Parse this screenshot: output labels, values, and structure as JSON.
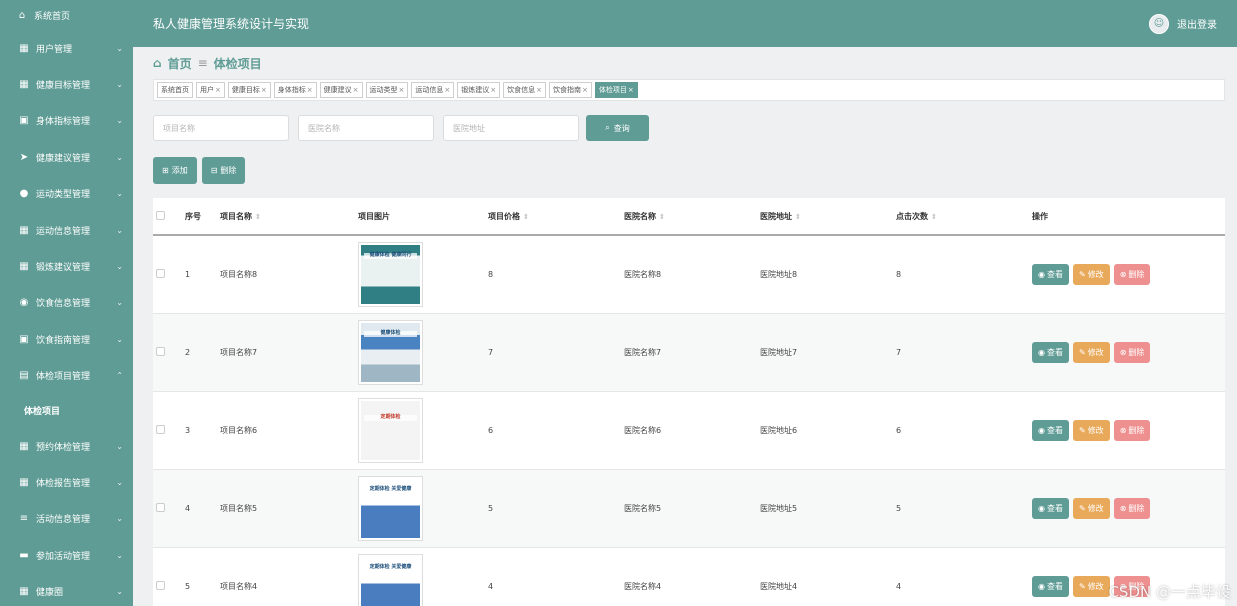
{
  "sidebar": {
    "home": {
      "label": "系统首页"
    },
    "items": [
      {
        "label": "用户管理",
        "icon": "grid-icon"
      },
      {
        "label": "健康目标管理",
        "icon": "grid-icon"
      },
      {
        "label": "身体指标管理",
        "icon": "clipboard-icon"
      },
      {
        "label": "健康建议管理",
        "icon": "send-icon"
      },
      {
        "label": "运动类型管理",
        "icon": "user-icon"
      },
      {
        "label": "运动信息管理",
        "icon": "grid-icon"
      },
      {
        "label": "锻炼建议管理",
        "icon": "grid-icon"
      },
      {
        "label": "饮食信息管理",
        "icon": "bulb-icon"
      },
      {
        "label": "饮食指南管理",
        "icon": "clipboard-icon"
      },
      {
        "label": "体检项目管理",
        "icon": "comment-icon",
        "expanded": true
      },
      {
        "label": "预约体检管理",
        "icon": "grid-icon"
      },
      {
        "label": "体检报告管理",
        "icon": "grid-icon"
      },
      {
        "label": "活动信息管理",
        "icon": "list-icon"
      },
      {
        "label": "参加活动管理",
        "icon": "briefcase-icon"
      },
      {
        "label": "健康圈",
        "icon": "grid-icon"
      }
    ],
    "sub_item": {
      "label": "体检项目"
    }
  },
  "header": {
    "title": "私人健康管理系统设计与实现",
    "logout": "退出登录"
  },
  "breadcrumb": {
    "home": "首页",
    "sep": "≡",
    "current": "体检项目"
  },
  "tags": [
    {
      "label": "系统首页",
      "closable": false
    },
    {
      "label": "用户",
      "closable": true
    },
    {
      "label": "健康目标",
      "closable": true
    },
    {
      "label": "身体指标",
      "closable": true
    },
    {
      "label": "健康建议",
      "closable": true
    },
    {
      "label": "运动类型",
      "closable": true
    },
    {
      "label": "运动信息",
      "closable": true
    },
    {
      "label": "锻炼建议",
      "closable": true
    },
    {
      "label": "饮食信息",
      "closable": true
    },
    {
      "label": "饮食指南",
      "closable": true
    },
    {
      "label": "体检项目",
      "closable": true,
      "active": true
    }
  ],
  "search": {
    "name_placeholder": "项目名称",
    "hospital_placeholder": "医院名称",
    "address_placeholder": "医院地址",
    "button": "查询"
  },
  "actions": {
    "add": "添加",
    "delete": "删除"
  },
  "table": {
    "headers": {
      "idx": "序号",
      "name": "项目名称",
      "image": "项目图片",
      "price": "项目价格",
      "hospital": "医院名称",
      "address": "医院地址",
      "clicks": "点击次数",
      "ops": "操作"
    },
    "op_labels": {
      "view": "查看",
      "edit": "修改",
      "del": "删除"
    },
    "rows": [
      {
        "idx": "1",
        "name": "项目名称8",
        "price": "8",
        "hospital": "医院名称8",
        "address": "医院地址8",
        "clicks": "8",
        "poster_text": "健康体检 健康同行"
      },
      {
        "idx": "2",
        "name": "项目名称7",
        "price": "7",
        "hospital": "医院名称7",
        "address": "医院地址7",
        "clicks": "7",
        "poster_text": "健康体检"
      },
      {
        "idx": "3",
        "name": "项目名称6",
        "price": "6",
        "hospital": "医院名称6",
        "address": "医院地址6",
        "clicks": "6",
        "poster_text": "定期体检"
      },
      {
        "idx": "4",
        "name": "项目名称5",
        "price": "5",
        "hospital": "医院名称5",
        "address": "医院地址5",
        "clicks": "5",
        "poster_text": "定期体检 关爱健康"
      },
      {
        "idx": "5",
        "name": "项目名称4",
        "price": "4",
        "hospital": "医院名称4",
        "address": "医院地址4",
        "clicks": "4",
        "poster_text": "定期体检 关爱健康"
      }
    ]
  },
  "watermark": "CSDN @一点毕设",
  "colors": {
    "primary": "#5f9c95",
    "edit": "#e9a95a",
    "danger": "#ef9090"
  }
}
